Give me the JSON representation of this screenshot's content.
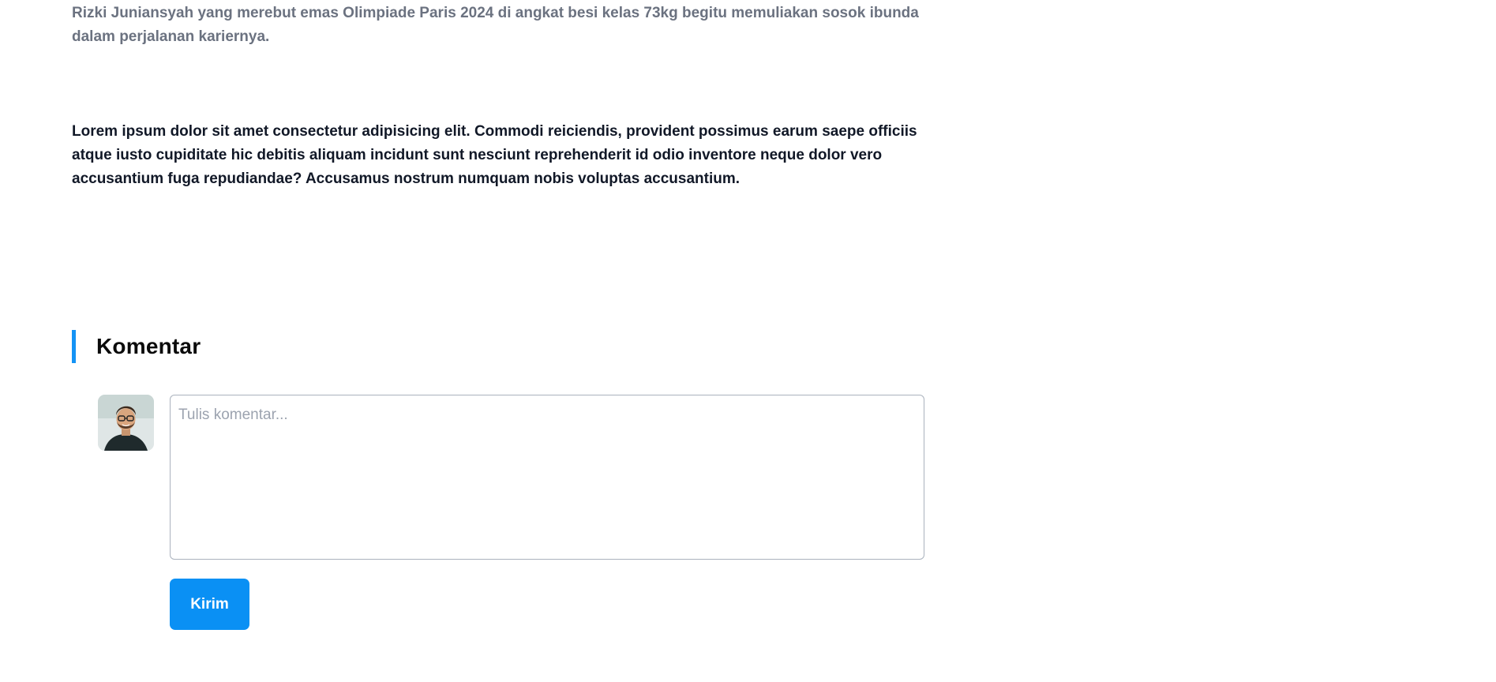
{
  "article": {
    "lead": "Rizki Juniansyah yang merebut emas Olimpiade Paris 2024 di angkat besi kelas 73kg begitu memuliakan sosok ibunda dalam perjalanan kariernya.",
    "body": "Lorem ipsum dolor sit amet consectetur adipisicing elit. Commodi reiciendis, provident possimus earum saepe officiis atque iusto cupiditate hic debitis aliquam incidunt sunt nesciunt reprehenderit id odio inventore neque dolor vero accusantium fuga repudiandae? Accusamus nostrum numquam nobis voluptas accusantium."
  },
  "comments": {
    "title": "Komentar",
    "placeholder": "Tulis komentar...",
    "submit_label": "Kirim",
    "accent_color": "#1493f5",
    "button_color": "#0a90f4"
  },
  "icons": {
    "avatar": "user-avatar-photo"
  }
}
